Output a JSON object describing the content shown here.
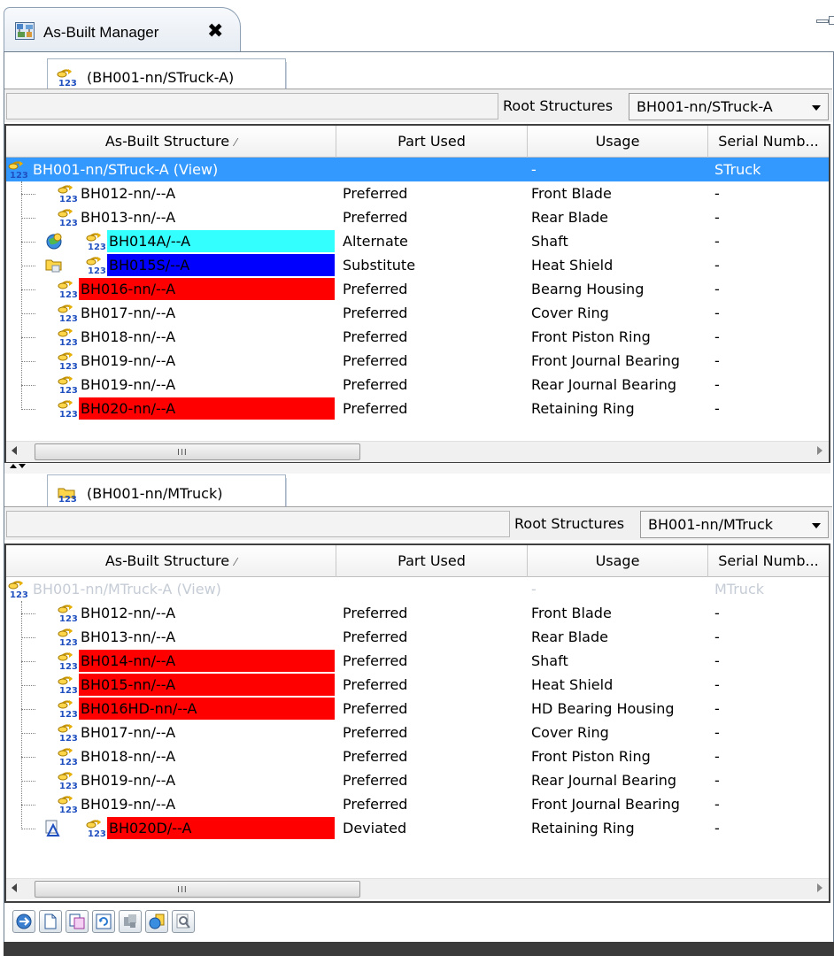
{
  "view_tab": {
    "title": "As-Built Manager",
    "close_glyph": "✖"
  },
  "icons": {
    "view": "as-built-manager-icon",
    "structure": "structure-123-icon",
    "alternate": "alternate-globe-icon",
    "substitute": "substitute-folder-icon",
    "deviated": "deviation-triangle-icon"
  },
  "colors": {
    "selection": "#3399ff",
    "alternate_highlight": "#33ffff",
    "substitute_highlight": "#0000ff",
    "error_highlight": "#ff0000",
    "grey_text": "#c5ccd6"
  },
  "columns": {
    "structure": "As-Built Structure",
    "part_used": "Part Used",
    "usage": "Usage",
    "serial": "Serial Numb..."
  },
  "scrollbar": {
    "grip": "III"
  },
  "pane1": {
    "tab_label": "(BH001-nn/STruck-A)",
    "root_label": "Root Structures",
    "root_value": "BH001-nn/STruck-A",
    "rows": [
      {
        "name": "BH001-nn/STruck-A (View)",
        "part_used": "",
        "usage": "-",
        "serial": "STruck"
      },
      {
        "name": "BH012-nn/--A",
        "part_used": "Preferred",
        "usage": "Front Blade",
        "serial": "-"
      },
      {
        "name": "BH013-nn/--A",
        "part_used": "Preferred",
        "usage": "Rear Blade",
        "serial": "-"
      },
      {
        "name": "BH014A/--A",
        "part_used": "Alternate",
        "usage": "Shaft",
        "serial": "-"
      },
      {
        "name": "BH015S/--A",
        "part_used": "Substitute",
        "usage": "Heat Shield",
        "serial": "-"
      },
      {
        "name": "BH016-nn/--A",
        "part_used": "Preferred",
        "usage": "Bearng Housing",
        "serial": "-"
      },
      {
        "name": "BH017-nn/--A",
        "part_used": "Preferred",
        "usage": "Cover Ring",
        "serial": "-"
      },
      {
        "name": "BH018-nn/--A",
        "part_used": "Preferred",
        "usage": "Front Piston Ring",
        "serial": "-"
      },
      {
        "name": "BH019-nn/--A",
        "part_used": "Preferred",
        "usage": "Front Journal Bearing",
        "serial": "-"
      },
      {
        "name": "BH019-nn/--A",
        "part_used": "Preferred",
        "usage": "Rear Journal Bearing",
        "serial": "-"
      },
      {
        "name": "BH020-nn/--A",
        "part_used": "Preferred",
        "usage": "Retaining Ring",
        "serial": "-"
      }
    ]
  },
  "pane2": {
    "tab_label": "(BH001-nn/MTruck)",
    "root_label": "Root Structures",
    "root_value": "BH001-nn/MTruck",
    "rows": [
      {
        "name": "BH001-nn/MTruck-A (View)",
        "part_used": "",
        "usage": "-",
        "serial": "MTruck"
      },
      {
        "name": "BH012-nn/--A",
        "part_used": "Preferred",
        "usage": "Front Blade",
        "serial": "-"
      },
      {
        "name": "BH013-nn/--A",
        "part_used": "Preferred",
        "usage": "Rear Blade",
        "serial": "-"
      },
      {
        "name": "BH014-nn/--A",
        "part_used": "Preferred",
        "usage": "Shaft",
        "serial": "-"
      },
      {
        "name": "BH015-nn/--A",
        "part_used": "Preferred",
        "usage": "Heat Shield",
        "serial": "-"
      },
      {
        "name": "BH016HD-nn/--A",
        "part_used": "Preferred",
        "usage": "HD Bearing Housing",
        "serial": "-"
      },
      {
        "name": "BH017-nn/--A",
        "part_used": "Preferred",
        "usage": "Cover Ring",
        "serial": "-"
      },
      {
        "name": "BH018-nn/--A",
        "part_used": "Preferred",
        "usage": "Front Piston Ring",
        "serial": "-"
      },
      {
        "name": "BH019-nn/--A",
        "part_used": "Preferred",
        "usage": "Rear Journal Bearing",
        "serial": "-"
      },
      {
        "name": "BH019-nn/--A",
        "part_used": "Preferred",
        "usage": "Front Journal Bearing",
        "serial": "-"
      },
      {
        "name": "BH020D/--A",
        "part_used": "Deviated",
        "usage": "Retaining Ring",
        "serial": "-"
      }
    ]
  },
  "bottom_toolbar": [
    {
      "icon": "navigate-icon"
    },
    {
      "icon": "new-document-icon"
    },
    {
      "icon": "compare-icon"
    },
    {
      "icon": "refresh-icon"
    },
    {
      "icon": "copy-structure-icon"
    },
    {
      "icon": "replace-part-icon"
    },
    {
      "icon": "search-icon"
    }
  ]
}
